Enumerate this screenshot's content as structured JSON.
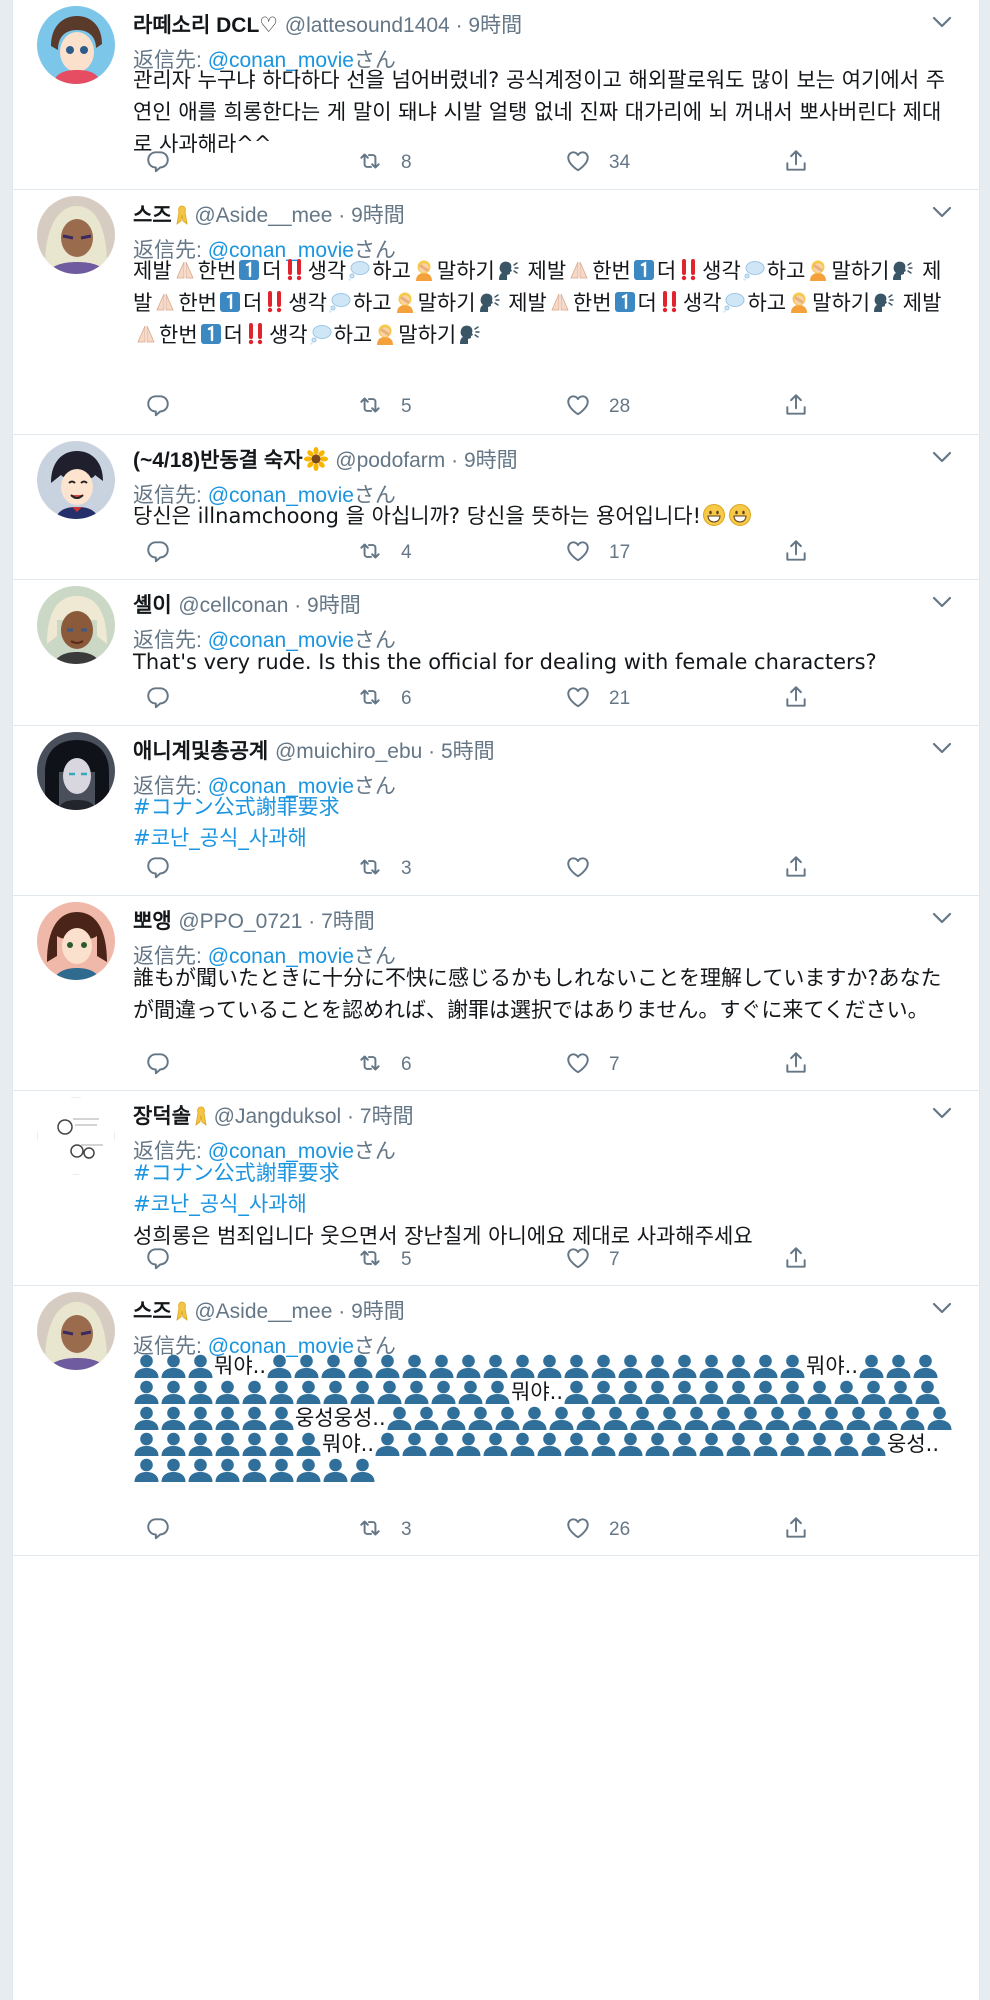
{
  "replying_to_label": "返信先:",
  "replying_to_suffix": "さん",
  "tweets": [
    {
      "name": "라떼소리 DCL♡",
      "handle": "@lattesound1404",
      "time": "9時間",
      "reply_to": "@conan_movie",
      "text": "관리자 누구냐 하다하다 선을 넘어버렸네? 공식계정이고 해외팔로워도 많이 보는 여기에서 주연인 애를 희롱한다는 게 말이 돼냐 시발 얼탱 없네 진짜 대가리에 뇌 꺼내서 뽀사버린다 제대로 사과해라^^",
      "replies": "",
      "retweets": "8",
      "likes": "34"
    },
    {
      "name": "스즈",
      "handle": "@Aside__mee",
      "time": "9時間",
      "reply_to": "@conan_movie",
      "text_segments": [
        "제발",
        "한번",
        "더",
        "생각",
        "하고",
        "말하기"
      ],
      "retweets": "5",
      "likes": "28"
    },
    {
      "name": "(~4/18)반동결 숙자",
      "handle": "@podofarm",
      "time": "9時間",
      "reply_to": "@conan_movie",
      "text": "당신은 illnamchoong 을 아십니까? 당신을 뜻하는 용어입니다!",
      "retweets": "4",
      "likes": "17"
    },
    {
      "name": "셸이",
      "handle": "@cellconan",
      "time": "9時間",
      "reply_to": "@conan_movie",
      "text": "That's very rude. Is this the official for dealing with female characters?",
      "retweets": "6",
      "likes": "21"
    },
    {
      "name": "애니계및총공계",
      "handle": "@muichiro_ebu",
      "time": "5時間",
      "reply_to": "@conan_movie",
      "hashtags": [
        "#コナン公式謝罪要求",
        "#코난_공식_사과해"
      ],
      "retweets": "3",
      "likes": ""
    },
    {
      "name": "뽀앵",
      "handle": "@PPO_0721",
      "time": "7時間",
      "reply_to": "@conan_movie",
      "text": "誰もが聞いたときに十分に不快に感じるかもしれないことを理解していますか?あなたが間違っていることを認めれば、謝罪は選択ではありません。すぐに来てください。",
      "retweets": "6",
      "likes": "7"
    },
    {
      "name": "장덕솔",
      "handle": "@Jangduksol",
      "time": "7時間",
      "reply_to": "@conan_movie",
      "hashtags": [
        "#コナン公式謝罪要求",
        "#코난_공식_사과해"
      ],
      "text": "성희롱은 범죄입니다 웃으면서 장난칠게 아니에요 제대로 사과해주세요",
      "retweets": "5",
      "likes": "7"
    },
    {
      "name": "스즈",
      "handle": "@Aside__mee",
      "time": "9時間",
      "reply_to": "@conan_movie",
      "words": [
        "뭐야..",
        "뭐야..",
        "뭐야..",
        "웅성웅성..",
        "뭐야..",
        "웅성.."
      ],
      "retweets": "3",
      "likes": "26"
    }
  ],
  "colors": {
    "link": "#1b95e0",
    "muted": "#657786",
    "text": "#14171a",
    "ribbon": "#f4c542",
    "bust": "#2f6f9a"
  }
}
